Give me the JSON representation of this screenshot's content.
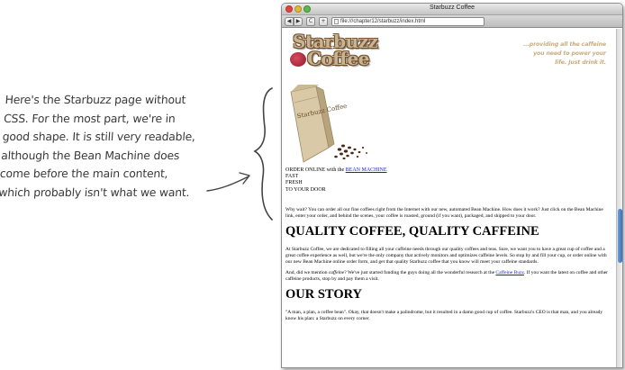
{
  "annotation": {
    "lines": [
      "Here's the Starbuzz page without",
      "CSS. For the most part, we're in",
      "good shape. It is still very readable,",
      "although the Bean Machine does",
      "come before the main content,",
      "which probably isn't what we want."
    ]
  },
  "browser": {
    "title": "Starbuzz Coffee",
    "url": "file:///chapter12/starbuzz/index.html",
    "back_label": "◀",
    "forward_label": "▶",
    "reload_label": "C",
    "add_label": "+"
  },
  "page": {
    "logo": {
      "line1": "Starbuzz",
      "line2": "Coffee"
    },
    "tagline": [
      "...providing all the caffeine",
      "you need to power your",
      "life. Just drink it."
    ],
    "bag_label": "Starbuzz Coffee",
    "order": {
      "prefix": "ORDER ONLINE with the ",
      "link": "BEAN MACHINE",
      "line2": "FAST",
      "line3": "FRESH",
      "line4": "TO YOUR DOOR"
    },
    "intro": "Why wait? You can order all our fine coffees right from the Internet with our new, automated Bean Machine. How does it work? Just click on the Bean Machine link, enter your order, and behind the scenes, your coffee is roasted, ground (if you want), packaged, and shipped to your door.",
    "heading1": "QUALITY COFFEE, QUALITY CAFFEINE",
    "para1": "At Starbuzz Coffee, we are dedicated to filling all your caffeine needs through our quality coffees and teas. Sure, we want you to have a great cup of coffee and a great coffee experience as well, but we're the only company that actively monitors and optimizes caffeine levels. So stop by and fill your cup, or order online with our new Bean Machine online order form, and get that quality Starbuzz coffee that you know will meet your caffeine standards.",
    "para2": {
      "before": "And, did we mention ",
      "em": "caffeine",
      "middle": "? We've just started funding the guys doing all the wonderful research at the ",
      "link": "Caffeine Buzz",
      "after": ". If you want the latest on coffee and other caffeine products, stop by and pay them a visit."
    },
    "heading2": "OUR STORY",
    "para3": "\"A man, a plan, a coffee bean\". Okay, that doesn't make a palindrome, but it resulted in a damn good cup of coffee. Starbuzz's CEO is that man, and you already know his plan: a Starbuzz on every corner."
  },
  "colors": {
    "link": "#1a1ad0",
    "logo_fill": "#c9b48f",
    "logo_outline": "#6b4b2a",
    "tagline": "#c7ac7d",
    "bag": "#d9c9a6",
    "scroll_thumb": "#3a70bb"
  }
}
